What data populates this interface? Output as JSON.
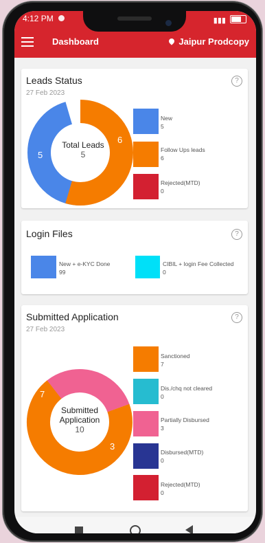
{
  "status": {
    "time": "4:12 PM",
    "battery": "47"
  },
  "header": {
    "title": "Dashboard",
    "location": "Jaipur Prodcopy"
  },
  "leads": {
    "title": "Leads Status",
    "date": "27 Feb 2023",
    "center_label": "Total Leads",
    "center_value": "5",
    "slice_left": "5",
    "slice_right": "6",
    "legend": [
      {
        "label": "New",
        "value": "5",
        "color": "#4a86e8"
      },
      {
        "label": "Follow Ups leads",
        "value": "6",
        "color": "#f57c00"
      },
      {
        "label": "Rejected(MTD)",
        "value": "0",
        "color": "#d32031"
      }
    ]
  },
  "login": {
    "title": "Login Files",
    "items": [
      {
        "label": "New + e-KYC Done",
        "value": "99",
        "color": "#4a86e8"
      },
      {
        "label": "CIBIL + login Fee Collected",
        "value": "0",
        "color": "#00e0f8"
      }
    ]
  },
  "submitted": {
    "title": "Submitted Application",
    "date": "27 Feb 2023",
    "center_line1": "Submitted",
    "center_line2": "Application",
    "center_value": "10",
    "slice_orange": "7",
    "slice_pink": "3",
    "legend": [
      {
        "label": "Sanctioned",
        "value": "7",
        "color": "#f57c00"
      },
      {
        "label": "Dis./chq not cleared",
        "value": "0",
        "color": "#26bcd0"
      },
      {
        "label": "Partially Disbursed",
        "value": "3",
        "color": "#f06292"
      },
      {
        "label": "Disbursed(MTD)",
        "value": "0",
        "color": "#283593"
      },
      {
        "label": "Rejected(MTD)",
        "value": "0",
        "color": "#d32031"
      }
    ]
  },
  "chart_data": [
    {
      "type": "pie",
      "title": "Leads Status",
      "categories": [
        "New",
        "Follow Ups leads",
        "Rejected(MTD)"
      ],
      "values": [
        5,
        6,
        0
      ]
    },
    {
      "type": "pie",
      "title": "Submitted Application",
      "categories": [
        "Sanctioned",
        "Dis./chq not cleared",
        "Partially Disbursed",
        "Disbursed(MTD)",
        "Rejected(MTD)"
      ],
      "values": [
        7,
        0,
        3,
        0,
        0
      ]
    }
  ]
}
